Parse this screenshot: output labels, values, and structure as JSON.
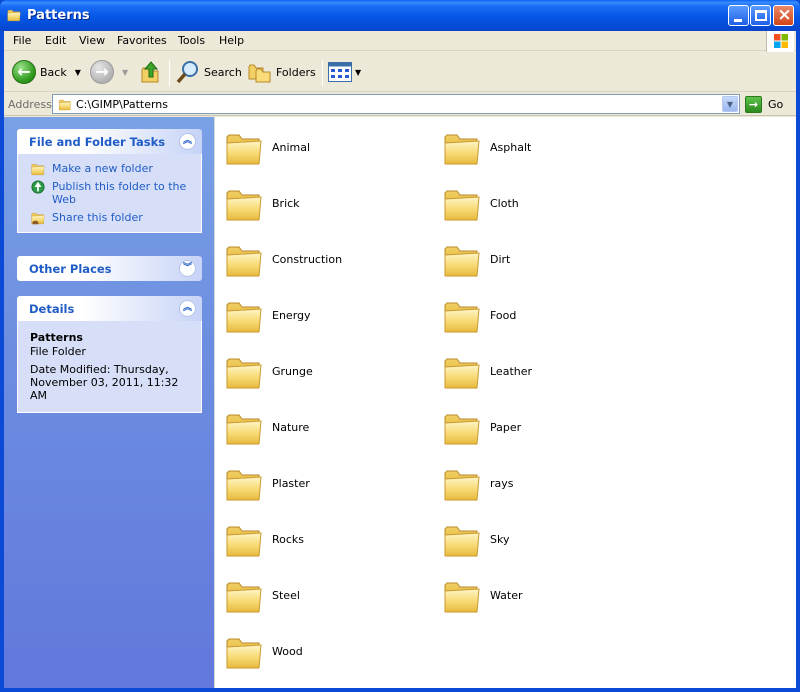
{
  "window": {
    "title": "Patterns"
  },
  "menu": [
    "File",
    "Edit",
    "View",
    "Favorites",
    "Tools",
    "Help"
  ],
  "toolbar": {
    "back_label": "Back",
    "search_label": "Search",
    "folders_label": "Folders"
  },
  "address": {
    "label": "Address",
    "value": "C:\\GIMP\\Patterns",
    "go_label": "Go"
  },
  "taskpane": {
    "file_tasks": {
      "title": "File and Folder Tasks",
      "items": [
        "Make a new folder",
        "Publish this folder to the Web",
        "Share this folder"
      ]
    },
    "other_places": {
      "title": "Other Places"
    },
    "details": {
      "title": "Details",
      "name": "Patterns",
      "type": "File Folder",
      "modified": "Date Modified: Thursday, November 03, 2011, 11:32 AM"
    }
  },
  "folders": [
    "Animal",
    "Asphalt",
    "Brick",
    "Cloth",
    "Construction",
    "Dirt",
    "Energy",
    "Food",
    "Grunge",
    "Leather",
    "Nature",
    "Paper",
    "Plaster",
    "rays",
    "Rocks",
    "Sky",
    "Steel",
    "Water",
    "Wood"
  ],
  "colors": {
    "title_bar": "#0a5ae8",
    "task_pane": "#6c8ee0",
    "link": "#215dc6",
    "folder": "#f3d36b"
  }
}
